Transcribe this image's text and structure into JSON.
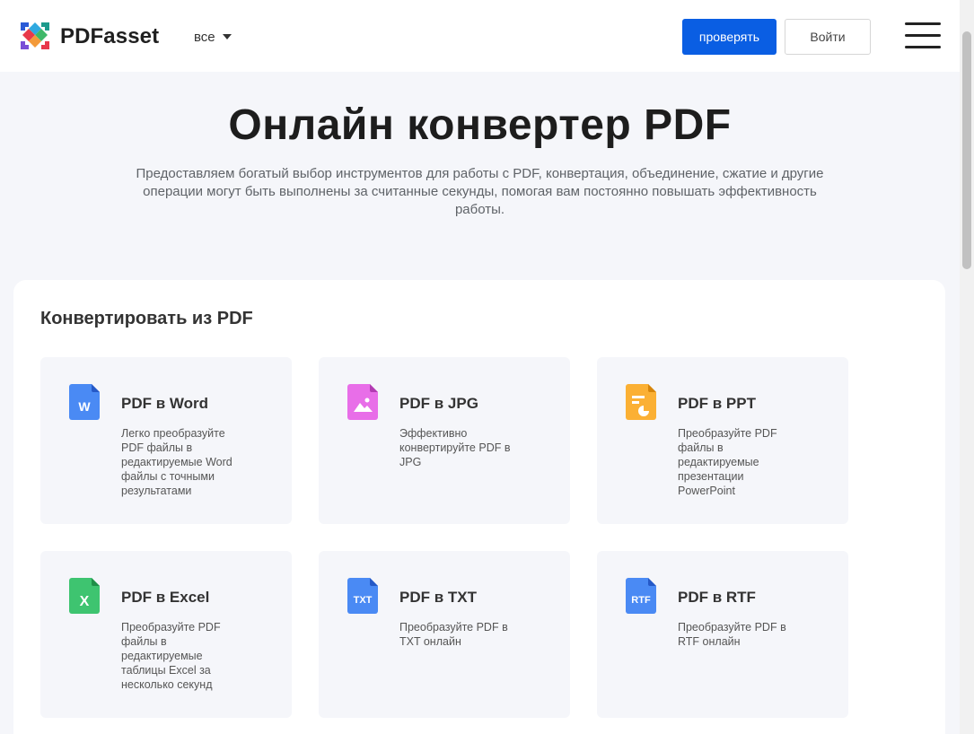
{
  "header": {
    "brand": "PDFasset",
    "language": "все",
    "check_button": "проверять",
    "login_button": "Войти"
  },
  "hero": {
    "title": "Онлайн конвертер PDF",
    "description": "Предоставляем богатый выбор инструментов для работы с PDF, конвертация, объединение, сжатие и другие операции могут быть выполнены за считанные секунды, помогая вам постоянно повышать эффективность работы."
  },
  "section": {
    "title": "Конвертировать из PDF",
    "tools": [
      {
        "title": "PDF в Word",
        "description": "Легко преобразуйте PDF файлы в редактируемые Word файлы с точными результатами",
        "icon": "word-file-icon",
        "color": "#4a8af4",
        "glyph": "W"
      },
      {
        "title": "PDF в JPG",
        "description": "Эффективно конвертируйте PDF в JPG",
        "icon": "image-file-icon",
        "color": "#e86ee8",
        "glyph": ""
      },
      {
        "title": "PDF в PPT",
        "description": "Преобразуйте PDF файлы в редактируемые презентации PowerPoint",
        "icon": "ppt-file-icon",
        "color": "#fbb034",
        "glyph": ""
      },
      {
        "title": "PDF в Excel",
        "description": "Преобразуйте PDF файлы в редактируемые таблицы Excel за несколько секунд",
        "icon": "excel-file-icon",
        "color": "#3ec470",
        "glyph": "X"
      },
      {
        "title": "PDF в TXT",
        "description": "Преобразуйте PDF в TXT онлайн",
        "icon": "txt-file-icon",
        "color": "#4a8af4",
        "glyph": "TXT"
      },
      {
        "title": "PDF в RTF",
        "description": "Преобразуйте PDF в RTF онлайн",
        "icon": "rtf-file-icon",
        "color": "#4a8af4",
        "glyph": "RTF"
      }
    ]
  }
}
